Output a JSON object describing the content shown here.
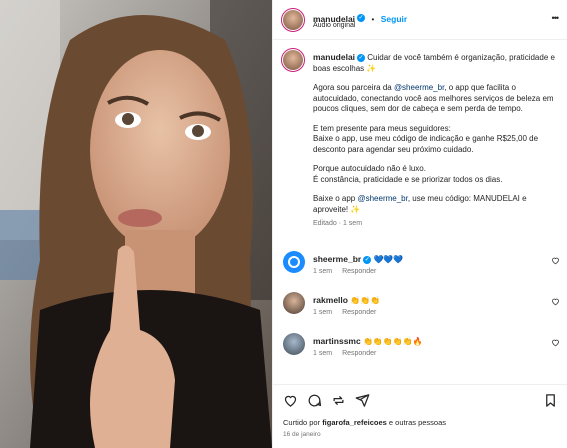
{
  "post": {
    "username": "manudelai",
    "follow_label": "Seguir",
    "audio_label": "Áudio original",
    "more_label": "•••",
    "caption_username": "manudelai",
    "caption_first": "Cuidar de você também é organização, praticidade e boas escolhas ✨",
    "p2_before": "Agora sou parceira da ",
    "p2_mention": "@sheerme_br",
    "p2_after": ", o app que facilita o autocuidado, conectando você aos melhores serviços de beleza em poucos cliques, sem dor de cabeça e sem perda de tempo.",
    "p3": "E tem presente para meus seguidores:\nBaixe o app, use meu código de indicação e ganhe R$25,00 de desconto para agendar seu próximo cuidado.",
    "p4": "Porque autocuidado não é luxo.\nÉ constância, praticidade e se priorizar todos os dias.",
    "p5_before": "Baixe o app ",
    "p5_mention": "@sheerme_br",
    "p5_after": ", use meu código: MANUDELAI e aproveite! ✨",
    "edited_label": "Editado · 1 sem"
  },
  "comments": [
    {
      "username": "sheerme_br",
      "text": "💙💙💙",
      "time": "1 sem",
      "reply": "Responder"
    },
    {
      "username": "rakmello",
      "text": "👏👏👏",
      "time": "1 sem",
      "reply": "Responder"
    },
    {
      "username": "martinssmc",
      "text": "👏👏👏👏👏🔥",
      "time": "1 sem",
      "reply": "Responder"
    }
  ],
  "footer": {
    "liked_by_prefix": "Curtido por ",
    "liked_by_user": "figarofa_refeicoes",
    "liked_by_suffix": " e outras pessoas",
    "date": "16 de janeiro"
  },
  "icons": [
    "heart-icon",
    "comment-icon",
    "repost-icon",
    "share-icon",
    "bookmark-icon",
    "verified-icon",
    "more-icon"
  ],
  "colors": {
    "link": "#0095f6",
    "mention": "#00376b",
    "muted": "#737373",
    "ring": "#c91c7a"
  }
}
